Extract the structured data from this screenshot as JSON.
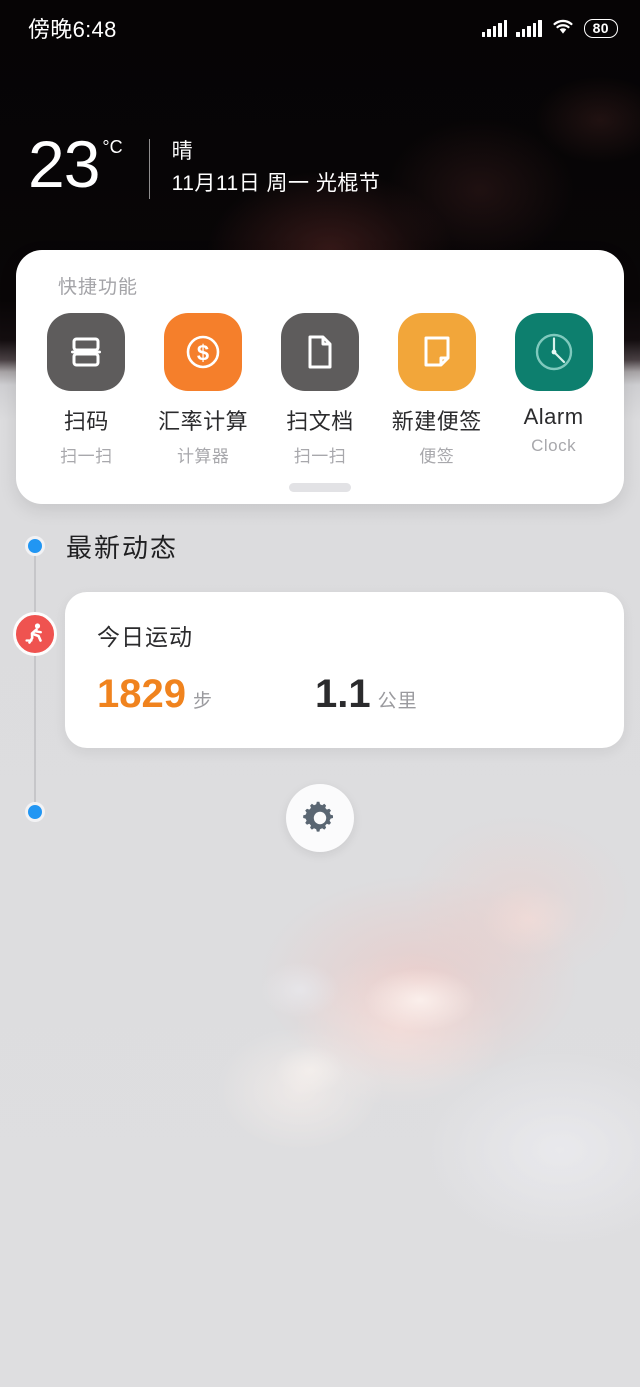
{
  "status_bar": {
    "time": "傍晚6:48",
    "signal_1_icon": "cellular-signal-icon",
    "signal_2_icon": "cellular-signal-icon",
    "wifi_icon": "wifi-icon",
    "battery_level": "80"
  },
  "weather": {
    "temperature": "23",
    "unit": "°C",
    "condition": "晴",
    "date": "11月11日 周一 光棍节"
  },
  "quick_functions": {
    "title": "快捷功能",
    "items": [
      {
        "label": "扫码",
        "sub": "扫一扫",
        "icon": "scan-code-icon",
        "color": "#5e5c5c"
      },
      {
        "label": "汇率计算",
        "sub": "计算器",
        "icon": "currency-dollar-icon",
        "color": "#f57f2b"
      },
      {
        "label": "扫文档",
        "sub": "扫一扫",
        "icon": "document-scan-icon",
        "color": "#5e5c5c"
      },
      {
        "label": "新建便签",
        "sub": "便签",
        "icon": "sticky-note-icon",
        "color": "#f2a63a"
      },
      {
        "label": "Alarm",
        "sub": "Clock",
        "icon": "alarm-clock-icon",
        "color": "#0d7f6e"
      }
    ],
    "handle": "card-drag-handle"
  },
  "feed": {
    "section_title": "最新动态",
    "exercise_card": {
      "title": "今日运动",
      "badge_icon": "running-person-icon",
      "stats": [
        {
          "value": "1829",
          "unit": "步",
          "color": "#f0831e"
        },
        {
          "value": "1.1",
          "unit": "公里",
          "color": "#2b2b2d"
        }
      ]
    },
    "timeline_dot_color": "#2196f3"
  },
  "settings_button": {
    "icon": "gear-icon",
    "color": "#5a6672"
  }
}
